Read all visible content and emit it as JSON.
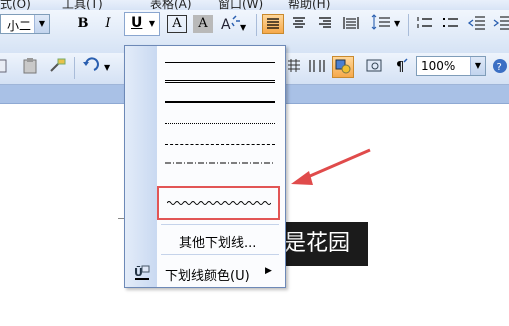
{
  "menubar": {
    "items": [
      {
        "label": "式(O)"
      },
      {
        "label": "工具(T)"
      },
      {
        "label": "表格(A)"
      },
      {
        "label": "窗口(W)"
      },
      {
        "label": "帮助(H)"
      }
    ]
  },
  "toolbar": {
    "font_size_value": "小二",
    "bold_label": "B",
    "italic_label": "I",
    "underline_label": "U",
    "char_border_label": "A",
    "char_shading_label": "A",
    "zoom_value": "100%"
  },
  "underline_menu": {
    "styles": [
      "single",
      "double",
      "thick",
      "dotted",
      "dashed",
      "dash-dot",
      "wavy"
    ],
    "selected_style": "wavy",
    "more_label": "其他下划线...",
    "color_label": "下划线颜色(U)"
  },
  "document": {
    "visible_text": "是花园↵"
  },
  "annotation": {
    "highlight_color": "#e25555",
    "arrow_color": "#e04b4b"
  }
}
